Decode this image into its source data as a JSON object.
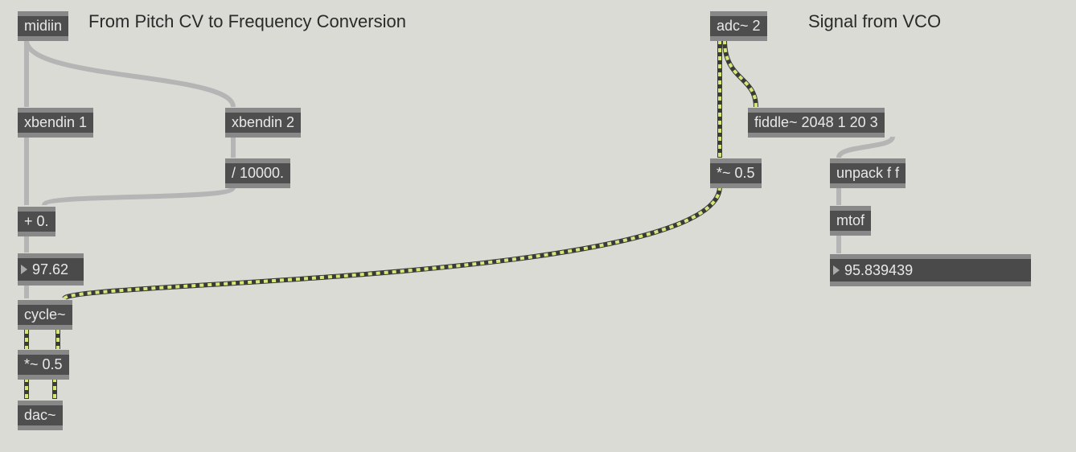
{
  "comments": {
    "left": "From Pitch CV to Frequency Conversion",
    "right": "Signal from VCO"
  },
  "boxes": {
    "midiin": "midiin",
    "xbendin1": "xbendin 1",
    "xbendin2": "xbendin 2",
    "div10000": "/ 10000.",
    "plus0": "+ 0.",
    "cycle": "cycle~",
    "mul05a": "*~ 0.5",
    "dac": "dac~",
    "adc2": "adc~ 2",
    "fiddle": "fiddle~ 2048 1 20 3",
    "mul05b": "*~ 0.5",
    "unpackff": "unpack f f",
    "mtof": "mtof"
  },
  "numbers": {
    "freq": "97.62",
    "fiddle_out": "95.839439"
  }
}
